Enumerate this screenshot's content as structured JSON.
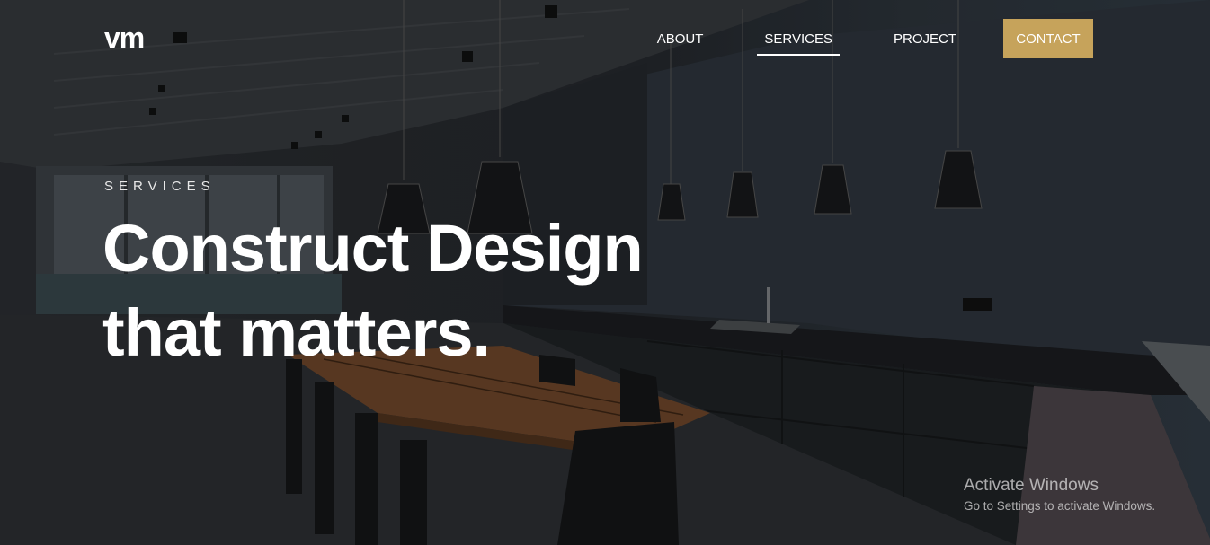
{
  "logo": {
    "text": "vm"
  },
  "nav": {
    "items": [
      {
        "label": "ABOUT"
      },
      {
        "label": "SERVICES",
        "active": true
      },
      {
        "label": "PROJECT"
      }
    ],
    "cta_label": "CONTACT",
    "cta_color": "#c6a35b"
  },
  "hero": {
    "eyebrow": "SERVICES",
    "headline_line1": "Construct Design",
    "headline_line2": "that matters."
  },
  "watermark": {
    "title": "Activate Windows",
    "subtitle": "Go to Settings to activate Windows."
  }
}
